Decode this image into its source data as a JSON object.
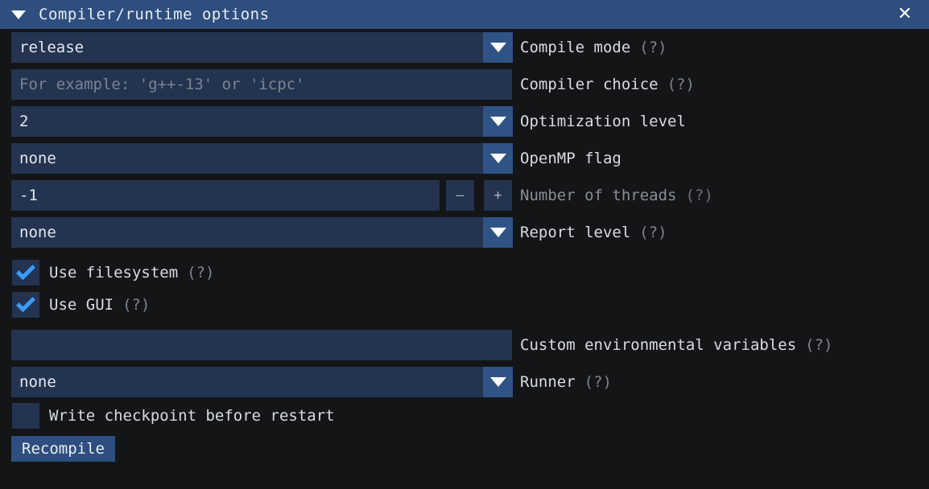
{
  "window": {
    "title": "Compiler/runtime options",
    "collapse_icon": "triangle-down-icon",
    "close_icon": "close-icon"
  },
  "colors": {
    "background": "#141517",
    "titlebar": "#2d4e7e",
    "field": "#233350",
    "arrow_button": "#2f5385",
    "checkmark": "#3a9cf5",
    "label_text": "#d7dde4",
    "help_text": "#7d858f",
    "disabled_text": "#878f99",
    "placeholder_text": "#7c8491"
  },
  "fields": {
    "compile_mode": {
      "value": "release",
      "label": "Compile mode",
      "help": "(?)",
      "type": "dropdown"
    },
    "compiler_choice": {
      "placeholder": "For example: 'g++-13' or 'icpc'",
      "value": "",
      "label": "Compiler choice",
      "help": "(?)",
      "type": "text"
    },
    "optimization_level": {
      "value": "2",
      "label": "Optimization level",
      "help": "",
      "type": "dropdown"
    },
    "openmp_flag": {
      "value": "none",
      "label": "OpenMP flag",
      "help": "",
      "type": "dropdown"
    },
    "number_of_threads": {
      "value": "-1",
      "label": "Number of threads",
      "help": "(?)",
      "type": "spinner",
      "decrement_label": "–",
      "increment_label": "+",
      "disabled": true
    },
    "report_level": {
      "value": "none",
      "label": "Report level",
      "help": "(?)",
      "type": "dropdown"
    },
    "custom_env_vars": {
      "value": "",
      "placeholder": "",
      "label": "Custom environmental variables",
      "help": "(?)",
      "type": "text"
    },
    "runner": {
      "value": "none",
      "label": "Runner",
      "help": "(?)",
      "type": "dropdown"
    }
  },
  "checkboxes": [
    {
      "label": "Use filesystem",
      "help": "(?)",
      "checked": true
    },
    {
      "label": "Use GUI",
      "help": "(?)",
      "checked": true
    },
    {
      "label": "Write checkpoint before restart",
      "help": "",
      "checked": false
    }
  ],
  "actions": {
    "recompile_label": "Recompile"
  }
}
